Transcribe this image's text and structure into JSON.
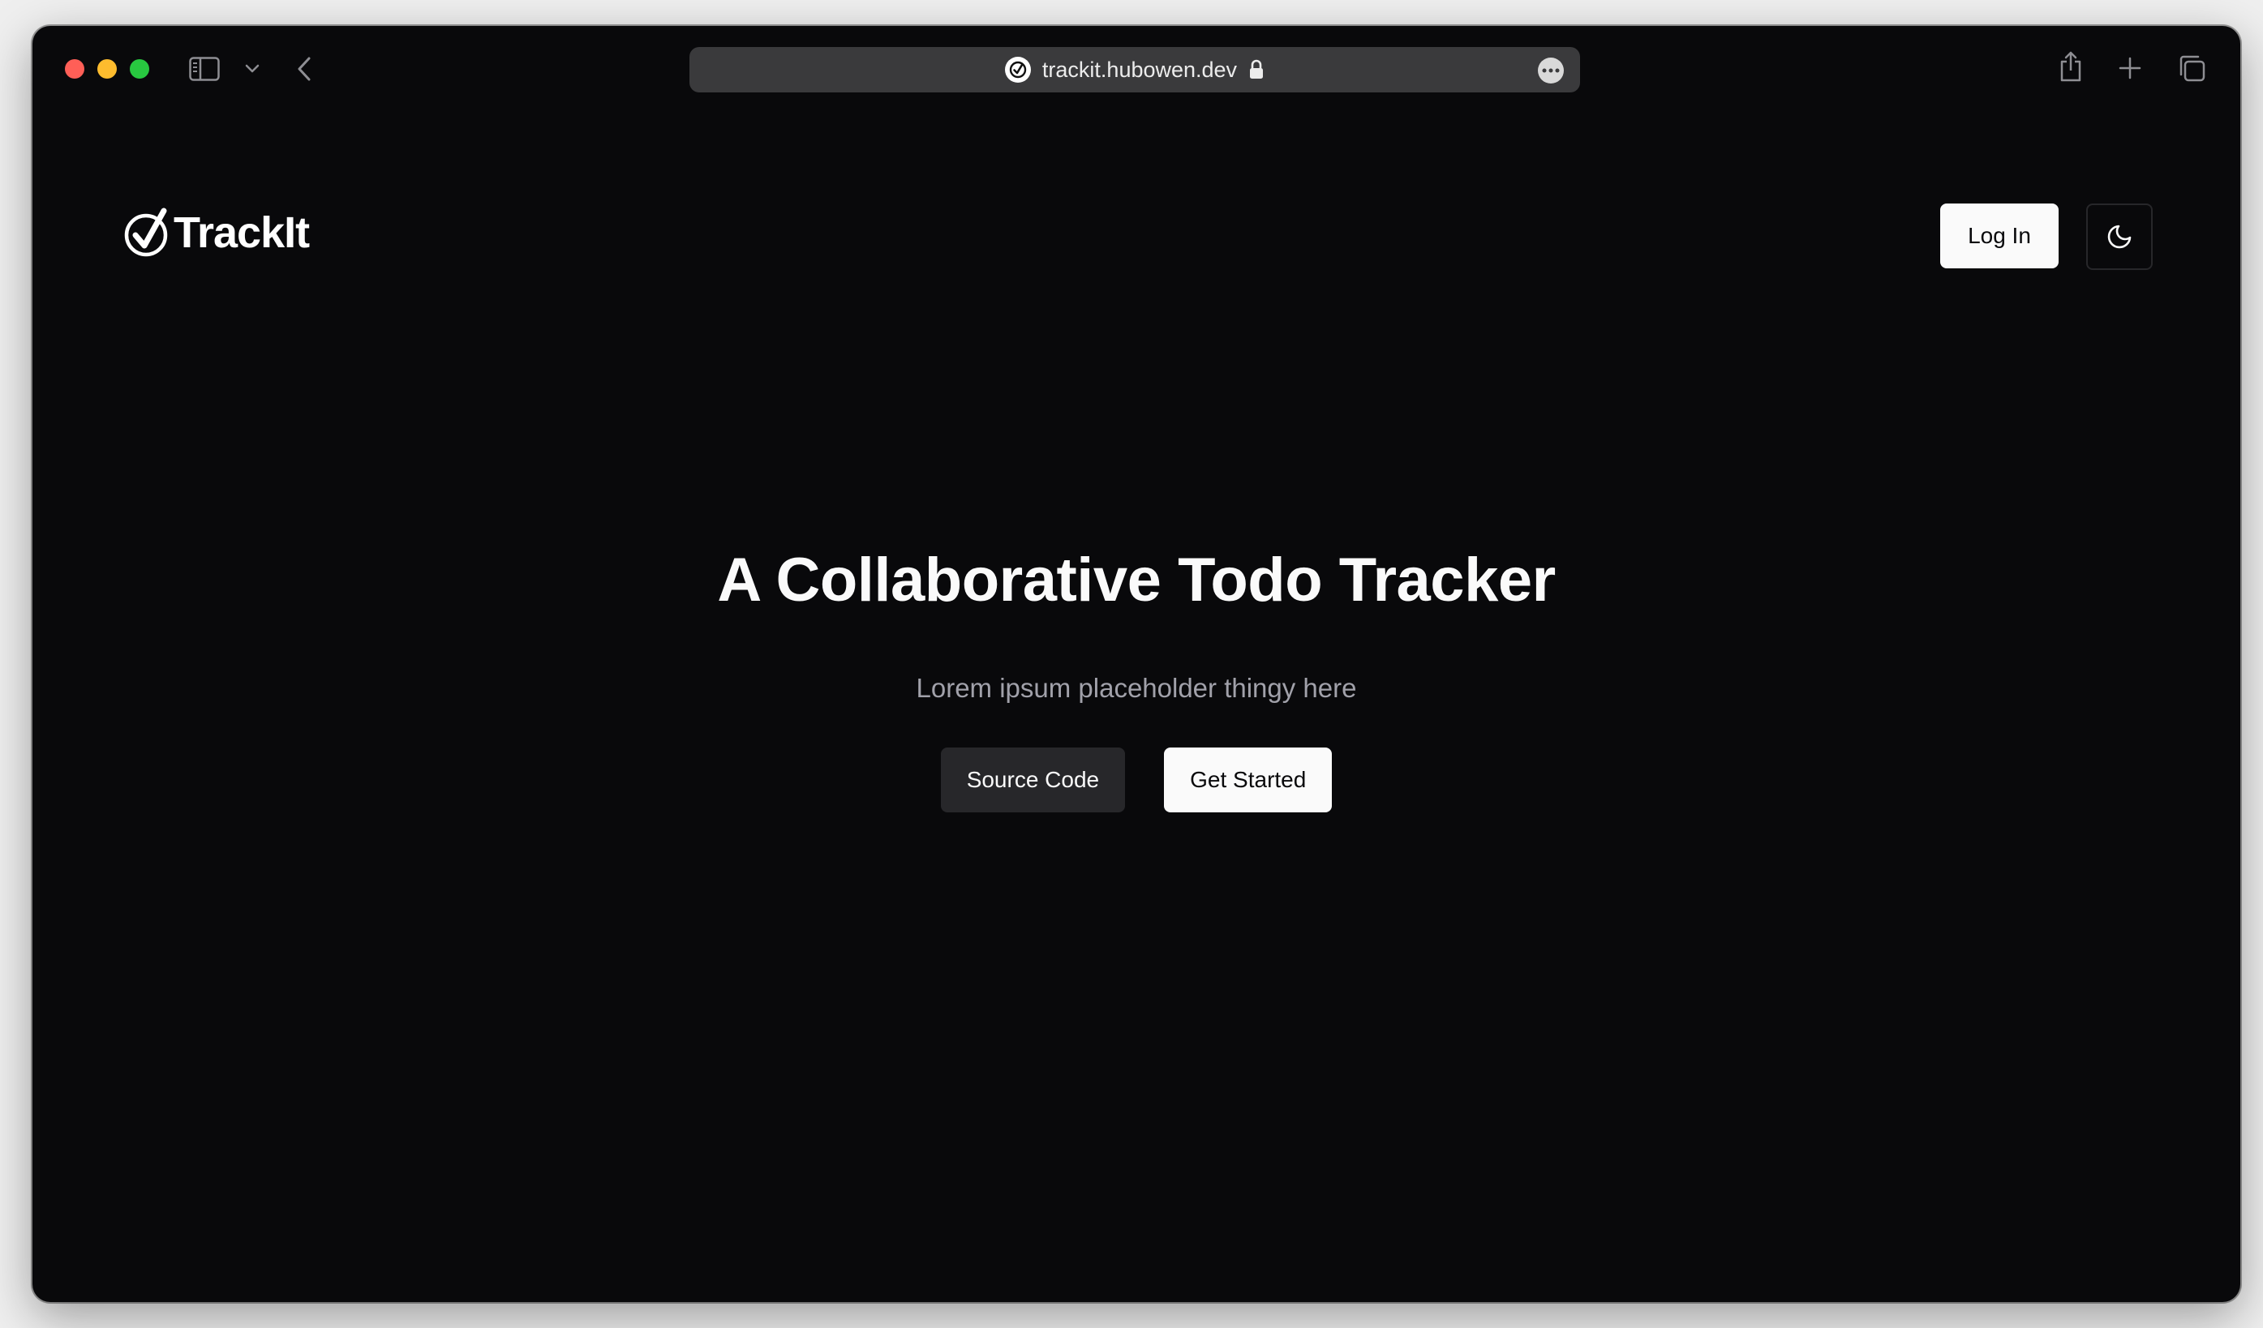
{
  "browser": {
    "url": "trackit.hubowen.dev",
    "controls": {
      "close": "close",
      "minimize": "minimize",
      "zoom": "zoom"
    },
    "icons": [
      "sidebar-icon",
      "chevron-down-icon",
      "back-icon",
      "favicon",
      "lock-icon",
      "more-icon",
      "share-icon",
      "new-tab-icon",
      "tabs-overview-icon"
    ]
  },
  "header": {
    "logo_text": "TrackIt",
    "login_label": "Log In",
    "theme_toggle_icon": "moon-icon"
  },
  "hero": {
    "title": "A Collaborative Todo Tracker",
    "subtitle": "Lorem ipsum placeholder thingy here",
    "source_code_label": "Source Code",
    "get_started_label": "Get Started"
  },
  "colors": {
    "background": "#09090b",
    "primary_button": "#fafafa",
    "secondary_button": "#27272a",
    "muted_text": "#a1a1aa"
  }
}
